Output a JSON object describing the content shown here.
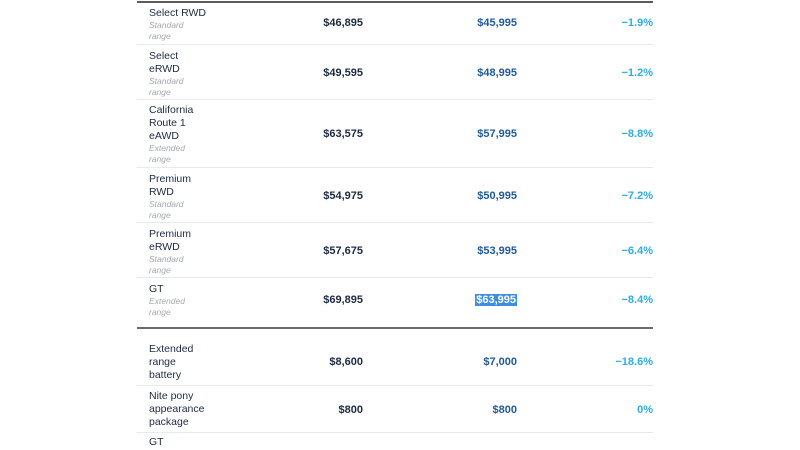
{
  "rows": [
    {
      "name": "Select RWD",
      "range": "Standard\nrange",
      "old_price": "$46,895",
      "new_price": "$45,995",
      "change": "−1.9%"
    },
    {
      "name": "Select\neRWD",
      "range": "Standard\nrange",
      "old_price": "$49,595",
      "new_price": "$48,995",
      "change": "−1.2%"
    },
    {
      "name": "California\nRoute 1\neAWD",
      "range": "Extended\nrange",
      "old_price": "$63,575",
      "new_price": "$57,995",
      "change": "−8.8%"
    },
    {
      "name": "Premium\nRWD",
      "range": "Standard\nrange",
      "old_price": "$54,975",
      "new_price": "$50,995",
      "change": "−7.2%"
    },
    {
      "name": "Premium\neRWD",
      "range": "Standard\nrange",
      "old_price": "$57,675",
      "new_price": "$53,995",
      "change": "−6.4%"
    },
    {
      "name": "GT",
      "range": "Extended\nrange",
      "old_price": "$69,895",
      "new_price": "$63,995",
      "change": "−8.4%"
    }
  ],
  "options": [
    {
      "name": "Extended\nrange\nbattery",
      "old_price": "$8,600",
      "new_price": "$7,000",
      "change": "−18.6%"
    },
    {
      "name": "Nite pony\nappearance\npackage",
      "old_price": "$800",
      "new_price": "$800",
      "change": "0%"
    },
    {
      "name": "GT"
    }
  ]
}
